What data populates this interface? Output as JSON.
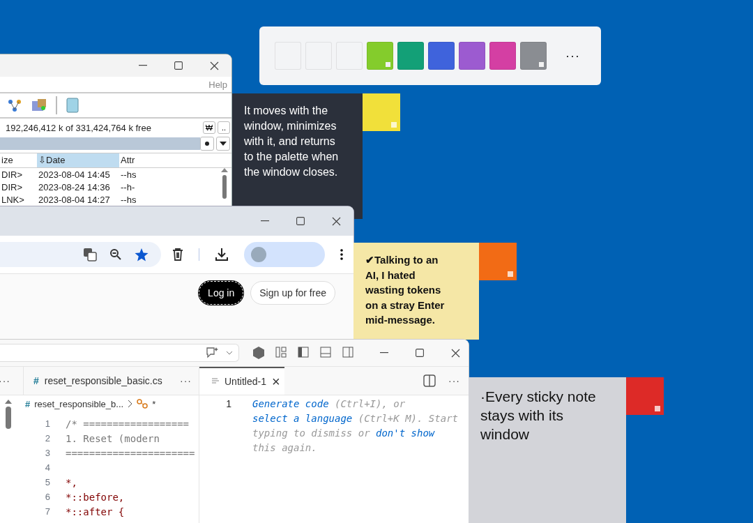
{
  "palette": {
    "swatches": [
      {
        "color": "#f3f4f6",
        "marked": false
      },
      {
        "color": "#f3f4f6",
        "marked": false
      },
      {
        "color": "#f3f4f6",
        "marked": false
      },
      {
        "color": "#84cc2c",
        "marked": true
      },
      {
        "color": "#13a077",
        "marked": false
      },
      {
        "color": "#3f63dc",
        "marked": false
      },
      {
        "color": "#9c5bd0",
        "marked": false
      },
      {
        "color": "#d43fa3",
        "marked": false
      },
      {
        "color": "#8a8d92",
        "marked": true
      }
    ],
    "more": "···"
  },
  "file_manager": {
    "menu": [
      "Help"
    ],
    "free_space": "192,246,412 k of 331,424,764 k free",
    "drive_buttons": [
      "₩",
      ".."
    ],
    "columns": [
      {
        "label": "ize",
        "selected": false
      },
      {
        "label": "⇩Date",
        "selected": true
      },
      {
        "label": "Attr",
        "selected": false
      }
    ],
    "rows": [
      {
        "size": "DIR>",
        "date": "2023-08-04 14:45",
        "attr": "--hs"
      },
      {
        "size": "DIR>",
        "date": "2023-08-24 14:36",
        "attr": "--h-"
      },
      {
        "size": "LNK>",
        "date": "2023-08-04 14:27",
        "attr": "--hs"
      }
    ]
  },
  "browser": {
    "buttons": [
      {
        "label": "Log in",
        "kind": "primary"
      },
      {
        "label": "Sign up for free",
        "kind": "outline"
      }
    ]
  },
  "editor": {
    "group_more": "···",
    "left_tab_icon": "#",
    "left_tab": "reset_responsible_basic.cs",
    "left_tab_more": "···",
    "breadcrumb_icon": "#",
    "breadcrumb": "reset_responsible_b...",
    "breadcrumb_tail": "*",
    "code": [
      {
        "num": "1",
        "text": "/* ==================",
        "color": "#777777"
      },
      {
        "num": "2",
        "text": "1. Reset (modern",
        "color": "#777777"
      },
      {
        "num": "3",
        "text": "======================",
        "color": "#777777"
      },
      {
        "num": "4"
      },
      {
        "num": "5",
        "text": "*,",
        "color": "#800000"
      },
      {
        "num": "6",
        "text": "*::before,",
        "color": "#800000"
      },
      {
        "num": "7",
        "text": "*::after {",
        "color": "#800000"
      }
    ],
    "right_tab": "Untitled-1",
    "close": "×",
    "right_more": "···",
    "line_number": "1",
    "hint": [
      {
        "t": "Generate code",
        "link": true
      },
      {
        "t": " (Ctrl+I), or ",
        "link": false
      },
      {
        "t": "select a language",
        "link": true
      },
      {
        "t": " (Ctrl+K M). Start typing to dismiss or ",
        "link": false
      },
      {
        "t": "don't show",
        "link": true
      },
      {
        "t": " this again.",
        "link": false
      }
    ]
  },
  "notes": [
    {
      "kind": "dark",
      "color": "#f1e03a",
      "text": "It moves with the window, minimizes with it, and returns to the palette when the window closes."
    },
    {
      "kind": "yellow",
      "color": "#f26b15",
      "text": "✔Talking to an AI, I hated wasting tokens on a stray Enter mid-message."
    },
    {
      "kind": "gray",
      "color": "#dd2a27",
      "text": "·Every sticky note stays with its window"
    }
  ]
}
